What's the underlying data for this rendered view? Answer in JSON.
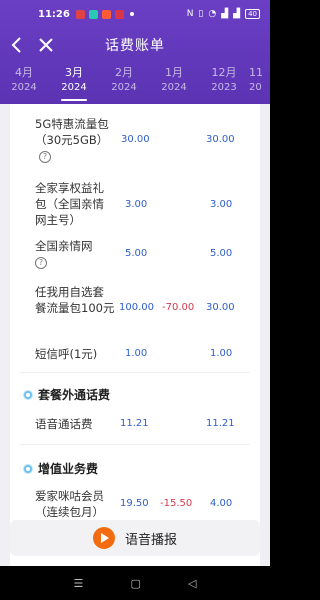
{
  "status_bar": {
    "time": "11:26",
    "battery": "40"
  },
  "nav": {
    "title": "话费账单"
  },
  "months": [
    {
      "month": "4月",
      "year": "2024"
    },
    {
      "month": "3月",
      "year": "2024"
    },
    {
      "month": "2月",
      "year": "2024"
    },
    {
      "month": "1月",
      "year": "2024"
    },
    {
      "month": "12月",
      "year": "2023"
    },
    {
      "month": "11",
      "year": "20"
    }
  ],
  "active_month_index": 1,
  "rows_top": [
    {
      "name": "5G特惠流量包（30元5GB）",
      "help": true,
      "c1": "30.00",
      "c2": "",
      "c3": "30.00"
    },
    {
      "name": "全家享权益礼包（全国亲情网主号）",
      "help": false,
      "c1": "3.00",
      "c2": "",
      "c3": "3.00"
    },
    {
      "name": "全国亲情网",
      "help": true,
      "c1": "5.00",
      "c2": "",
      "c3": "5.00"
    },
    {
      "name": "任我用自选套餐流量包100元",
      "help": false,
      "c1": "100.00",
      "c2": "-70.00",
      "c3": "30.00"
    },
    {
      "name": "短信呼(1元)",
      "help": false,
      "c1": "1.00",
      "c2": "",
      "c3": "1.00"
    }
  ],
  "section_outside": {
    "title": "套餐外通话费",
    "rows": [
      {
        "name": "语音通话费",
        "c1": "11.21",
        "c2": "",
        "c3": "11.21"
      }
    ]
  },
  "section_vas": {
    "title": "增值业务费",
    "rows": [
      {
        "name": "爱家咪咕会员（连续包月）",
        "c1": "19.50",
        "c2": "-15.50",
        "c3": "4.00"
      }
    ]
  },
  "voice": {
    "label": "语音播报"
  },
  "colors": {
    "header": "#6b3fc4",
    "amount": "#2f5fc7",
    "negative": "#d23a4d",
    "voice_accent": "#f36c11"
  }
}
